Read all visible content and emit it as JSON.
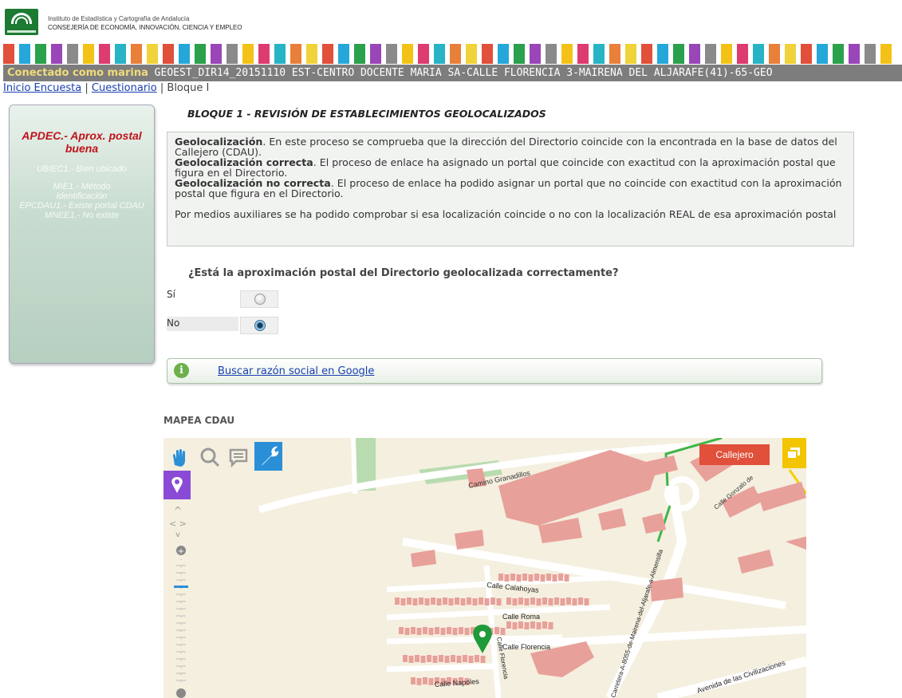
{
  "header": {
    "institute": "Instituto de Estadística y Cartografía de Andalucía",
    "department": "CONSEJERÍA DE ECONOMÍA, INNOVACIÓN, CIENCIA Y EMPLEO",
    "stripe_colors": [
      "#e0503a",
      "#25a8d9",
      "#2aa14c",
      "#9a46b8",
      "#8a8a8a",
      "#f4c217",
      "#de3c70",
      "#27b4c4",
      "#e8803a",
      "#f0d23a"
    ]
  },
  "userbar": {
    "connected": "Conectado como marina",
    "info": " GEOEST_DIR14_20151110 EST-CENTRO DOCENTE MARIA SA-CALLE FLORENCIA 3-MAIRENA DEL ALJARAFE(41)-65-GEO"
  },
  "breadcrumb": {
    "home": "Inicio Encuesta",
    "sep1": " | ",
    "questionnaire": "Cuestionario",
    "sep2": " | ",
    "current": "Bloque I"
  },
  "sidebar": {
    "title": "APDEC.- Aprox. postal buena",
    "items": [
      "UBIEC1.- Bien ubicado",
      "MIE1.- Método identificación",
      "EPCDAU1.- Existe portal CDAU",
      "MNEE1.- No existe"
    ]
  },
  "block": {
    "title": "BLOQUE 1 - REVISIÓN DE ESTABLECIMIENTOS GEOLOCALIZADOS",
    "geo_label": "Geolocalización",
    "geo_text": ". En este proceso se comprueba que la dirección del Directorio coincide con la encontrada en la base de datos del Callejero (CDAU).",
    "correct_label": "Geolocalización correcta",
    "correct_text": ". El proceso de enlace ha asignado un portal que coincide con exactitud con la aproximación postal que figura en el Directorio.",
    "incorrect_label": "Geolocalización no correcta",
    "incorrect_text": ". El proceso de enlace ha podido asignar un portal que no coincide con exactitud con la aproximación postal que figura en el Directorio.",
    "aux_text": "Por medios auxiliares se ha podido comprobar si esa localización coincide o no con la localización REAL de esa aproximación postal"
  },
  "question": {
    "text": "¿Está la aproximación postal del Directorio geolocalizada correctamente?",
    "options": [
      {
        "label": "Sí",
        "selected": false
      },
      {
        "label": "No",
        "selected": true
      }
    ]
  },
  "google": {
    "link": "Buscar razón social en Google"
  },
  "map": {
    "title": "MAPEA CDAU",
    "layer_button": "Callejero",
    "streets": {
      "granadillos": "Camino Granadillos",
      "gonzalo": "Calle Gonzalo de",
      "calahoyas": "Calle Calahoyas",
      "roma": "Calle Roma",
      "florencia": "Calle Florencia",
      "florencia_v": "Calle Florencia",
      "napoles": "Calle Napoles",
      "carretera": "Carretera-A-8055-de-Mairena-del-Aljarafe-a-Almensilla",
      "civilizaciones": "Avenida de las Civilizaciones"
    },
    "colors": {
      "background": "#f4efdf",
      "building": "#e8a09a",
      "road": "#ffffff",
      "green": "#b9dbb0",
      "accent": "#2b8fd8",
      "pin": "#1e9a3a"
    }
  }
}
